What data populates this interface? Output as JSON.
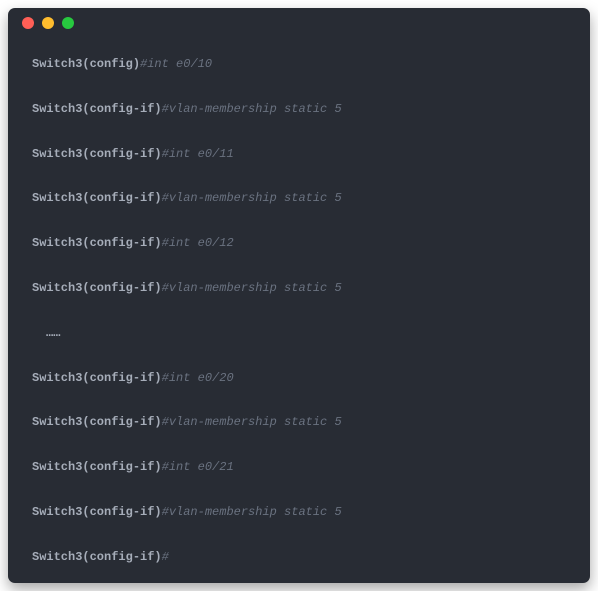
{
  "window": {
    "dots": [
      "red",
      "yellow",
      "green"
    ]
  },
  "lines": [
    {
      "prompt": "Switch3(config)",
      "hash": "#",
      "cmd": "int e0/10"
    },
    {
      "prompt": "Switch3(config-if)",
      "hash": "#",
      "cmd": "vlan-membership static 5"
    },
    {
      "prompt": "Switch3(config-if)",
      "hash": "#",
      "cmd": "int e0/11"
    },
    {
      "prompt": "Switch3(config-if)",
      "hash": "#",
      "cmd": "vlan-membership static 5"
    },
    {
      "prompt": "Switch3(config-if)",
      "hash": "#",
      "cmd": "int e0/12"
    },
    {
      "prompt": "Switch3(config-if)",
      "hash": "#",
      "cmd": "vlan-membership static 5"
    },
    {
      "ellipsis": "……"
    },
    {
      "prompt": "Switch3(config-if)",
      "hash": "#",
      "cmd": "int e0/20"
    },
    {
      "prompt": "Switch3(config-if)",
      "hash": "#",
      "cmd": "vlan-membership static 5"
    },
    {
      "prompt": "Switch3(config-if)",
      "hash": "#",
      "cmd": "int e0/21"
    },
    {
      "prompt": "Switch3(config-if)",
      "hash": "#",
      "cmd": "vlan-membership static 5"
    },
    {
      "prompt": "Switch3(config-if)",
      "hash": "#",
      "cmd": ""
    }
  ]
}
